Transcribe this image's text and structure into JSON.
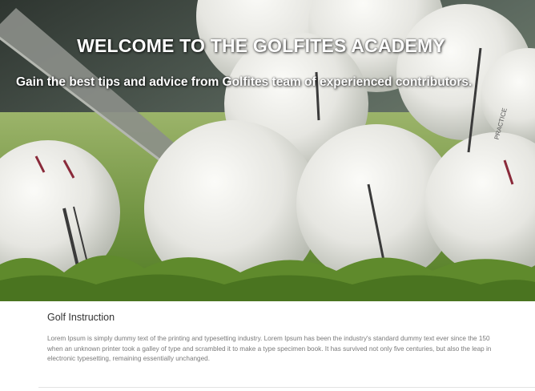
{
  "hero": {
    "title": "WELCOME TO THE GOLFITES ACADEMY",
    "subtitle": "Gain the best tips and advice from Golfites team of experienced contributors.",
    "ball_label": "PRACTICE"
  },
  "section": {
    "title": "Golf Instruction",
    "body_lines": [
      "Lorem Ipsum is simply dummy text of the printing and typesetting industry. Lorem Ipsum has been the industry's standard dummy text ever since the 150",
      "when an unknown printer took a galley of type and scrambled it to make a type specimen book. It has survived not only five centuries, but also the leap in",
      "electronic typesetting, remaining essentially unchanged."
    ]
  },
  "colors": {
    "text_dark": "#333333",
    "text_muted": "#7a7a7a",
    "divider": "#e3e3e3",
    "hero_text": "#ffffff",
    "grass": "#6c8c3a",
    "ball": "#eeeeea"
  }
}
